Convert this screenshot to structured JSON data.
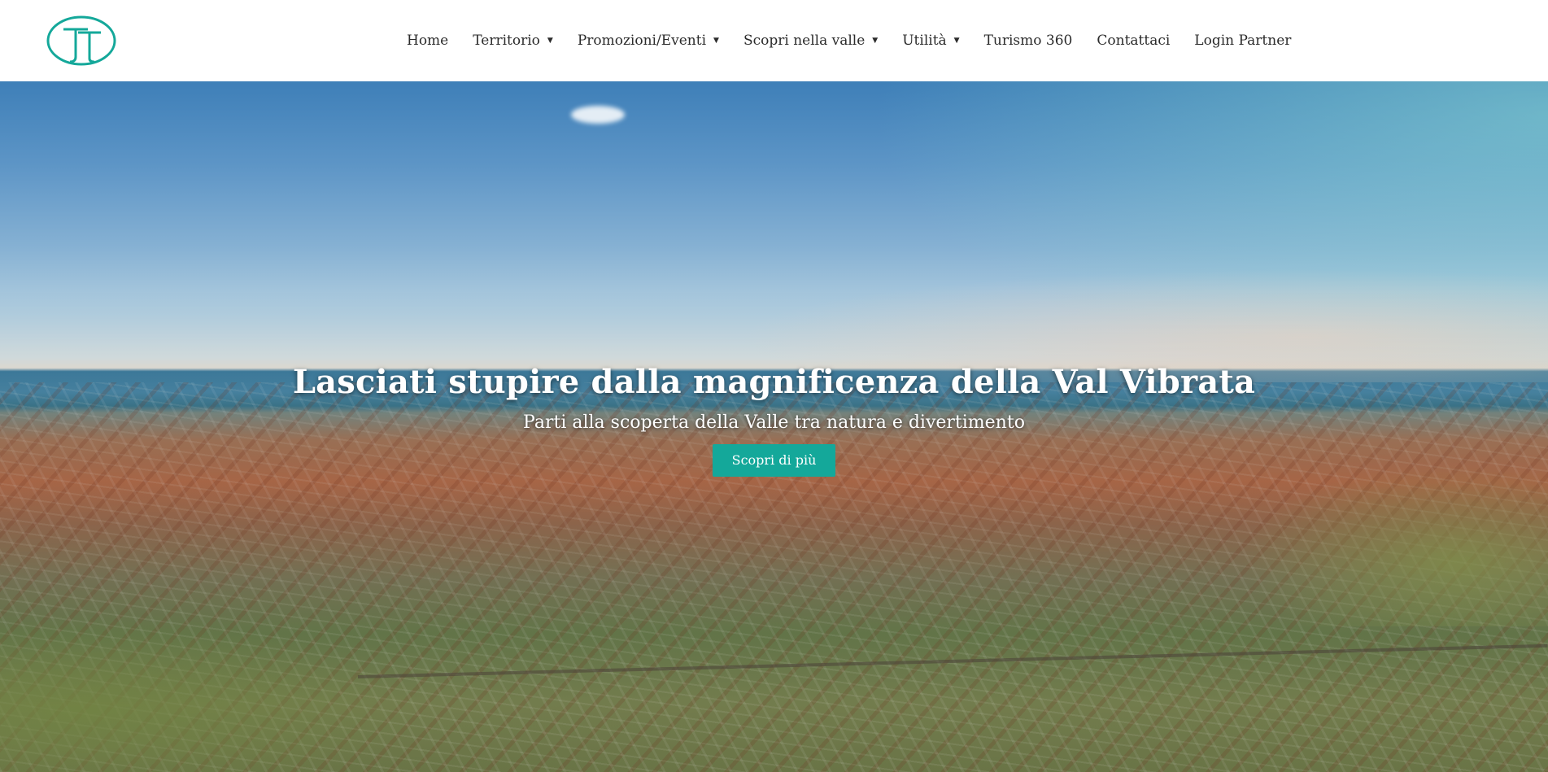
{
  "header": {
    "logo_icon": "tt-monogram-logo-icon",
    "brand_color": "#14a89a",
    "nav": [
      {
        "label": "Home",
        "has_dropdown": false
      },
      {
        "label": "Territorio",
        "has_dropdown": true
      },
      {
        "label": "Promozioni/Eventi",
        "has_dropdown": true
      },
      {
        "label": "Scopri nella valle",
        "has_dropdown": true
      },
      {
        "label": "Utilità",
        "has_dropdown": true
      },
      {
        "label": "Turismo 360",
        "has_dropdown": false
      },
      {
        "label": "Contattaci",
        "has_dropdown": false
      },
      {
        "label": "Login Partner",
        "has_dropdown": false
      }
    ],
    "dropdown_caret": "▼"
  },
  "hero": {
    "title": "Lasciati stupire dalla magnificenza della Val Vibrata",
    "subtitle": "Parti alla scoperta della Valle tra natura e divertimento",
    "button_label": "Scopri di più",
    "button_color": "#14a89a"
  }
}
